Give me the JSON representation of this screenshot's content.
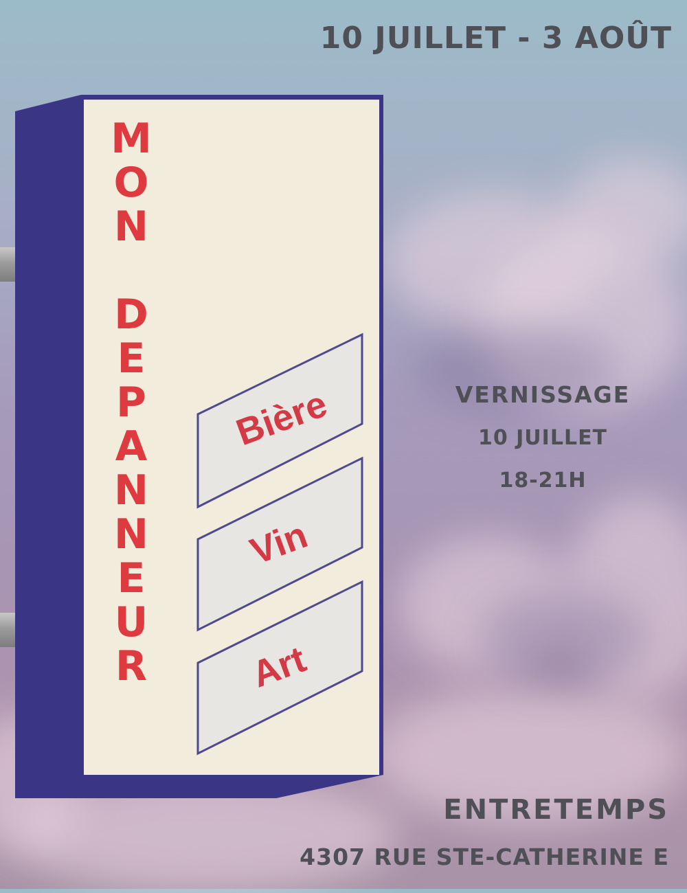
{
  "header": {
    "date_range": "10 JUILLET - 3 AOÛT"
  },
  "sign": {
    "name_words": [
      {
        "letters": [
          "M",
          "O",
          "N"
        ]
      },
      {
        "letters": [
          "D",
          "E",
          "P",
          "A",
          "N",
          "N",
          "E",
          "U",
          "R"
        ]
      }
    ],
    "panels": [
      {
        "label": "Bière"
      },
      {
        "label": "Vin"
      },
      {
        "label": "Art"
      }
    ]
  },
  "vernissage": {
    "title": "VERNISSAGE",
    "date": "10 JUILLET",
    "time": "18-21H"
  },
  "venue": {
    "name": "ENTRETEMPS",
    "address": "4307 RUE STE-CATHERINE E"
  },
  "colors": {
    "sign_face": "#f1ecdc",
    "sign_side": "#3a3585",
    "sign_red": "#dd3b3f",
    "text_gray": "#4f4f56"
  }
}
